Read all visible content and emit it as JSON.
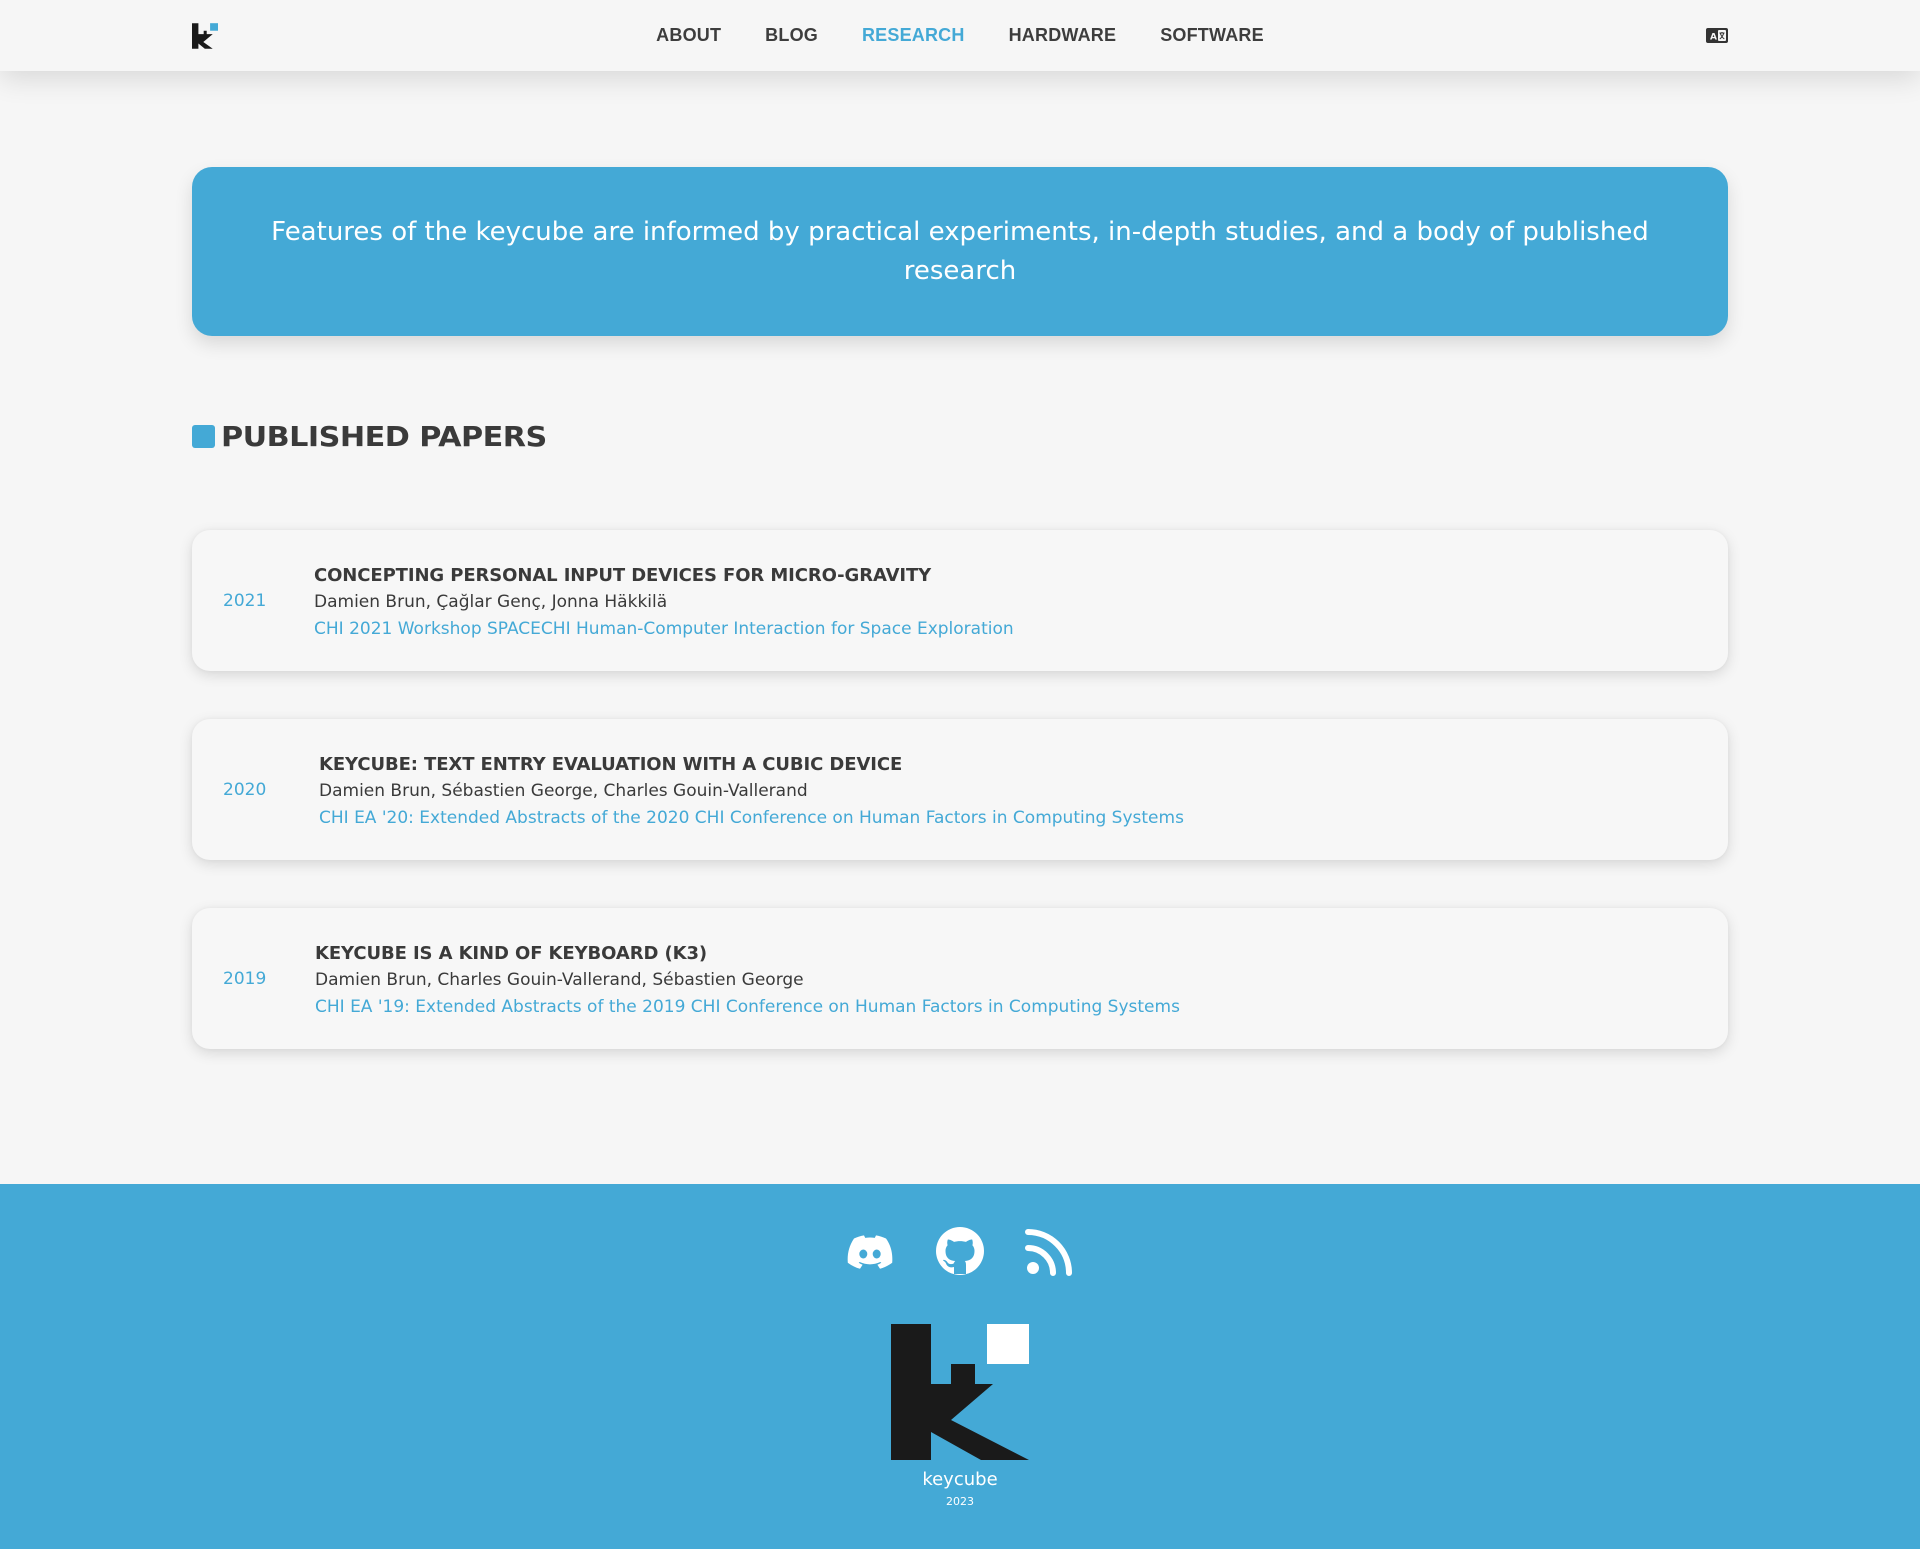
{
  "header": {
    "logo_icon": "keycube-k-logo-icon",
    "nav": [
      {
        "label": "ABOUT",
        "active": false
      },
      {
        "label": "BLOG",
        "active": false
      },
      {
        "label": "RESEARCH",
        "active": true
      },
      {
        "label": "HARDWARE",
        "active": false
      },
      {
        "label": "SOFTWARE",
        "active": false
      }
    ],
    "language_icon": "language-translate-icon"
  },
  "banner": {
    "text": "Features of the keycube are informed by practical experiments, in-depth studies, and a body of published research"
  },
  "section": {
    "title": "PUBLISHED PAPERS"
  },
  "papers": [
    {
      "year": "2021",
      "title": "CONCEPTING PERSONAL INPUT DEVICES FOR MICRO-GRAVITY",
      "authors": "Damien Brun, Çağlar Genç, Jonna Häkkilä",
      "venue": "CHI 2021 Workshop SPACECHI Human-Computer Interaction for Space Exploration"
    },
    {
      "year": "2020",
      "title": "KEYCUBE: TEXT ENTRY EVALUATION WITH A CUBIC DEVICE",
      "authors": "Damien Brun, Sébastien George, Charles Gouin-Vallerand",
      "venue": "CHI EA '20: Extended Abstracts of the 2020 CHI Conference on Human Factors in Computing Systems"
    },
    {
      "year": "2019",
      "title": "KEYCUBE IS A KIND OF KEYBOARD (K3)",
      "authors": "Damien Brun, Charles Gouin-Vallerand, Sébastien George",
      "venue": "CHI EA '19: Extended Abstracts of the 2019 CHI Conference on Human Factors in Computing Systems"
    }
  ],
  "footer": {
    "social_icons": [
      "discord-icon",
      "github-icon",
      "rss-icon"
    ],
    "brand": "keycube",
    "year": "2023"
  },
  "colors": {
    "accent": "#44a9d6",
    "background": "#f6f6f6",
    "text": "#3a3a3a",
    "logo_dark": "#1a1a1a"
  }
}
